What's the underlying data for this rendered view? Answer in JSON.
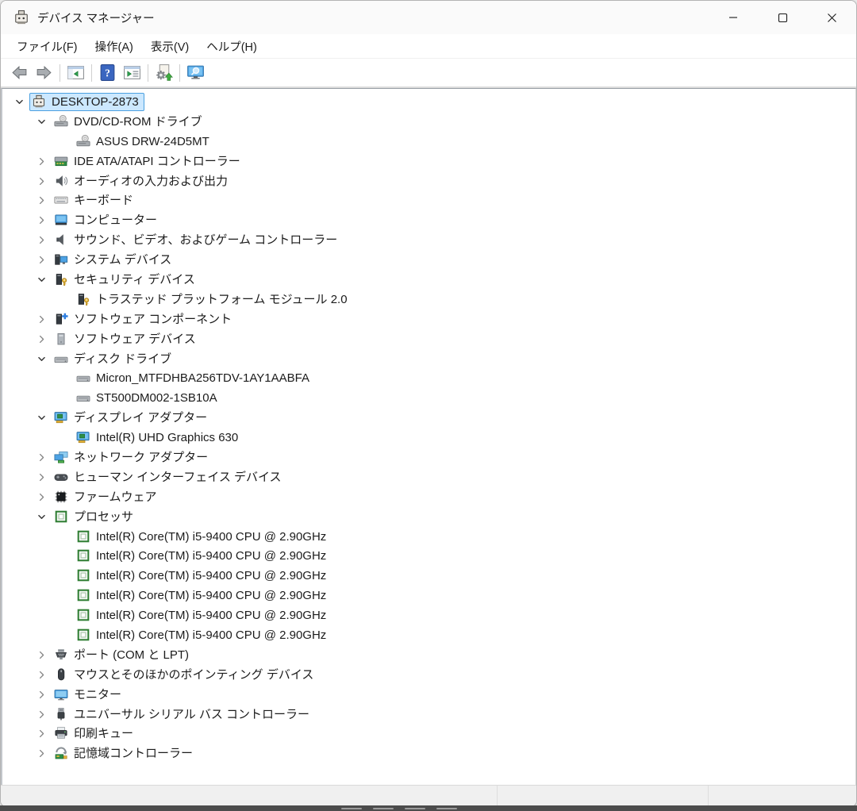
{
  "window": {
    "title": "デバイス マネージャー",
    "app_icon": "device-manager-icon",
    "controls": [
      "minimize",
      "maximize",
      "close"
    ]
  },
  "menu": {
    "items": [
      {
        "label": "ファイル(F)"
      },
      {
        "label": "操作(A)"
      },
      {
        "label": "表示(V)"
      },
      {
        "label": "ヘルプ(H)"
      }
    ]
  },
  "toolbar": {
    "buttons": [
      {
        "icon": "back-icon"
      },
      {
        "icon": "forward-icon"
      },
      {
        "icon": "console-tree-icon"
      },
      {
        "icon": "help-icon"
      },
      {
        "icon": "properties-icon"
      },
      {
        "icon": "update-driver-icon"
      },
      {
        "icon": "scan-hardware-icon"
      }
    ]
  },
  "tree": {
    "items": [
      {
        "level": 0,
        "state": "expanded",
        "selected": true,
        "icon": "computer-icon",
        "label": "DESKTOP-2873"
      },
      {
        "level": 1,
        "state": "expanded",
        "selected": false,
        "icon": "cd-drive-icon",
        "label": "DVD/CD-ROM ドライブ"
      },
      {
        "level": 2,
        "state": "leaf",
        "selected": false,
        "icon": "cd-drive-icon",
        "label": "ASUS DRW-24D5MT"
      },
      {
        "level": 1,
        "state": "collapsed",
        "selected": false,
        "icon": "ide-controller-icon",
        "label": "IDE ATA/ATAPI コントローラー"
      },
      {
        "level": 1,
        "state": "collapsed",
        "selected": false,
        "icon": "audio-endpoint-icon",
        "label": "オーディオの入力および出力"
      },
      {
        "level": 1,
        "state": "collapsed",
        "selected": false,
        "icon": "keyboard-icon",
        "label": "キーボード"
      },
      {
        "level": 1,
        "state": "collapsed",
        "selected": false,
        "icon": "computer-monitor-icon",
        "label": "コンピューター"
      },
      {
        "level": 1,
        "state": "collapsed",
        "selected": false,
        "icon": "speaker-icon",
        "label": "サウンド、ビデオ、およびゲーム コントローラー"
      },
      {
        "level": 1,
        "state": "collapsed",
        "selected": false,
        "icon": "system-devices-icon",
        "label": "システム デバイス"
      },
      {
        "level": 1,
        "state": "expanded",
        "selected": false,
        "icon": "security-device-icon",
        "label": "セキュリティ デバイス"
      },
      {
        "level": 2,
        "state": "leaf",
        "selected": false,
        "icon": "security-device-icon",
        "label": "トラステッド プラットフォーム モジュール 2.0"
      },
      {
        "level": 1,
        "state": "collapsed",
        "selected": false,
        "icon": "software-component-icon",
        "label": "ソフトウェア コンポーネント"
      },
      {
        "level": 1,
        "state": "collapsed",
        "selected": false,
        "icon": "software-device-icon",
        "label": "ソフトウェア デバイス"
      },
      {
        "level": 1,
        "state": "expanded",
        "selected": false,
        "icon": "disk-drive-icon",
        "label": "ディスク ドライブ"
      },
      {
        "level": 2,
        "state": "leaf",
        "selected": false,
        "icon": "disk-drive-icon",
        "label": "Micron_MTFDHBA256TDV-1AY1AABFA"
      },
      {
        "level": 2,
        "state": "leaf",
        "selected": false,
        "icon": "disk-drive-icon",
        "label": "ST500DM002-1SB10A"
      },
      {
        "level": 1,
        "state": "expanded",
        "selected": false,
        "icon": "display-adapter-icon",
        "label": "ディスプレイ アダプター"
      },
      {
        "level": 2,
        "state": "leaf",
        "selected": false,
        "icon": "display-adapter-icon",
        "label": "Intel(R) UHD Graphics 630"
      },
      {
        "level": 1,
        "state": "collapsed",
        "selected": false,
        "icon": "network-adapter-icon",
        "label": "ネットワーク アダプター"
      },
      {
        "level": 1,
        "state": "collapsed",
        "selected": false,
        "icon": "hid-icon",
        "label": "ヒューマン インターフェイス デバイス"
      },
      {
        "level": 1,
        "state": "collapsed",
        "selected": false,
        "icon": "firmware-icon",
        "label": "ファームウェア"
      },
      {
        "level": 1,
        "state": "expanded",
        "selected": false,
        "icon": "processor-icon",
        "label": "プロセッサ"
      },
      {
        "level": 2,
        "state": "leaf",
        "selected": false,
        "icon": "processor-icon",
        "label": "Intel(R) Core(TM) i5-9400 CPU @ 2.90GHz"
      },
      {
        "level": 2,
        "state": "leaf",
        "selected": false,
        "icon": "processor-icon",
        "label": "Intel(R) Core(TM) i5-9400 CPU @ 2.90GHz"
      },
      {
        "level": 2,
        "state": "leaf",
        "selected": false,
        "icon": "processor-icon",
        "label": "Intel(R) Core(TM) i5-9400 CPU @ 2.90GHz"
      },
      {
        "level": 2,
        "state": "leaf",
        "selected": false,
        "icon": "processor-icon",
        "label": "Intel(R) Core(TM) i5-9400 CPU @ 2.90GHz"
      },
      {
        "level": 2,
        "state": "leaf",
        "selected": false,
        "icon": "processor-icon",
        "label": "Intel(R) Core(TM) i5-9400 CPU @ 2.90GHz"
      },
      {
        "level": 2,
        "state": "leaf",
        "selected": false,
        "icon": "processor-icon",
        "label": "Intel(R) Core(TM) i5-9400 CPU @ 2.90GHz"
      },
      {
        "level": 1,
        "state": "collapsed",
        "selected": false,
        "icon": "serial-port-icon",
        "label": "ポート (COM と LPT)"
      },
      {
        "level": 1,
        "state": "collapsed",
        "selected": false,
        "icon": "mouse-icon",
        "label": "マウスとそのほかのポインティング デバイス"
      },
      {
        "level": 1,
        "state": "collapsed",
        "selected": false,
        "icon": "monitor-icon",
        "label": "モニター"
      },
      {
        "level": 1,
        "state": "collapsed",
        "selected": false,
        "icon": "usb-icon",
        "label": "ユニバーサル シリアル バス コントローラー"
      },
      {
        "level": 1,
        "state": "collapsed",
        "selected": false,
        "icon": "print-queue-icon",
        "label": "印刷キュー"
      },
      {
        "level": 1,
        "state": "collapsed",
        "selected": false,
        "icon": "storage-controller-icon",
        "label": "記憶域コントローラー"
      }
    ]
  },
  "statusbar": {
    "sections": [
      "",
      "",
      ""
    ]
  },
  "colors": {
    "selection_bg": "#cce8ff",
    "selection_border": "#4ba0e0",
    "titlebar_bg": "#fafafa",
    "statusbar_bg": "#f0f0f0",
    "taskbar_strip": "#4c4c4c"
  }
}
